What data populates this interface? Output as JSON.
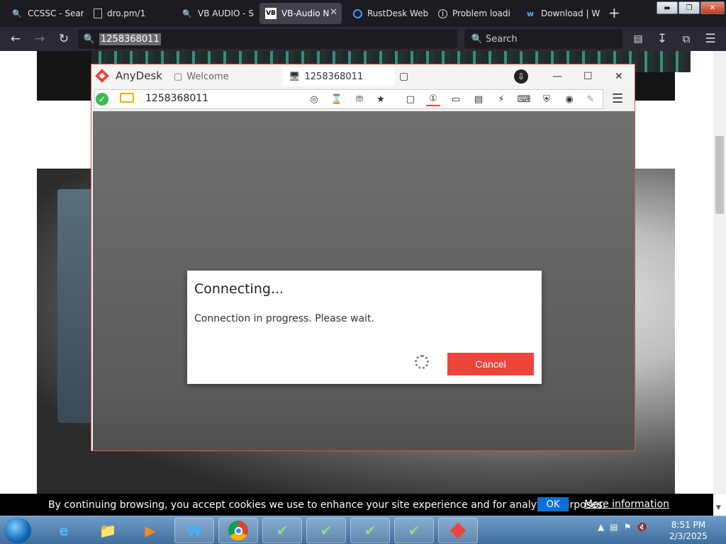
{
  "browser": {
    "tabs": [
      {
        "label": "CCSSC - Sear",
        "icon": "search-icon"
      },
      {
        "label": "dro.pm/1",
        "icon": "page-icon"
      },
      {
        "label": "VB AUDIO - Sea",
        "icon": "search-icon"
      },
      {
        "label": "VB-Audio N",
        "icon": "vb-logo-icon",
        "active": true
      },
      {
        "label": "RustDesk Web",
        "icon": "rustdesk-icon"
      },
      {
        "label": "Problem loadi",
        "icon": "info-icon"
      },
      {
        "label": "Download | W",
        "icon": "w-logo-icon"
      }
    ],
    "address": "1258368011",
    "search_placeholder": "Search",
    "vb_icon_text": "VB"
  },
  "anydesk": {
    "app_name": "AnyDesk",
    "tab_welcome": "Welcome",
    "tab_session": "1258368011",
    "address": "1258368011",
    "accent": "#ef443b",
    "dialog": {
      "title": "Connecting...",
      "message": "Connection in progress. Please wait.",
      "cancel_label": "Cancel"
    }
  },
  "cookie_banner": {
    "message": "By continuing browsing, you accept cookies we use to enhance your site experience and for analytics purposes.",
    "ok_label": "OK",
    "more_label": "More information"
  },
  "taskbar": {
    "time": "8:51 PM",
    "date": "2/3/2025"
  }
}
